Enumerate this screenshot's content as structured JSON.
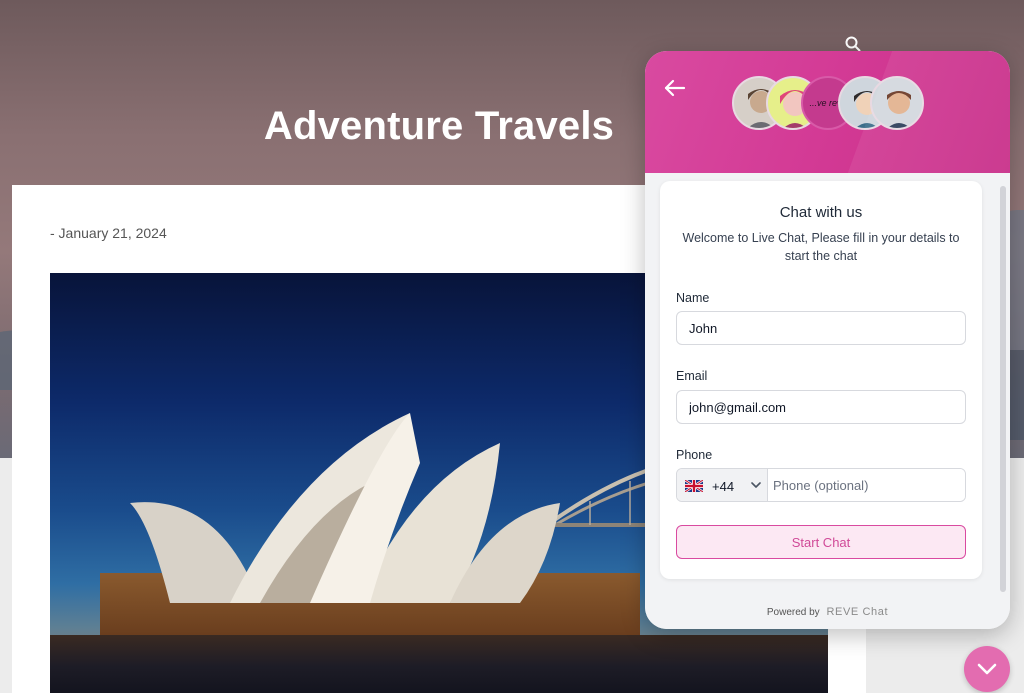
{
  "site": {
    "title": "Adventure Travels"
  },
  "post": {
    "date": "- January 21, 2024"
  },
  "chat": {
    "avatar_center_text": "...ve reve",
    "title": "Chat with us",
    "subtitle": "Welcome to Live Chat, Please fill in your details to start the chat",
    "name_label": "Name",
    "name_value": "John",
    "email_label": "Email",
    "email_value": "john@gmail.com",
    "phone_label": "Phone",
    "phone_dial_code": "+44",
    "phone_placeholder": "Phone (optional)",
    "start_button": "Start Chat",
    "powered_by": "Powered by",
    "brand": "REVE Chat"
  },
  "colors": {
    "accent": "#d94aa0",
    "button_bg": "#fce8f3",
    "scroll_button": "#e36cb0"
  },
  "icons": [
    "search-icon",
    "back-arrow-icon",
    "uk-flag-icon",
    "chevron-down-icon",
    "scroll-down-icon"
  ]
}
